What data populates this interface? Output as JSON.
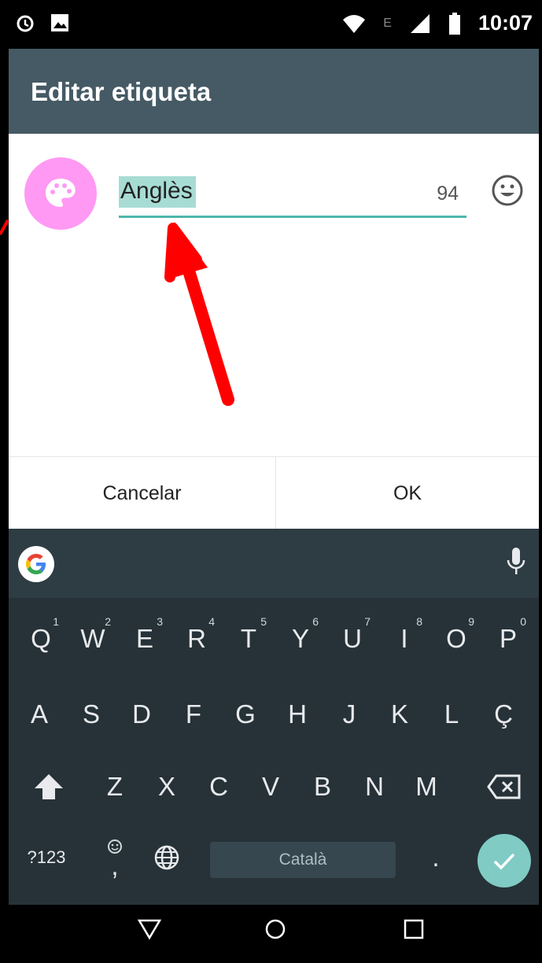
{
  "status_bar": {
    "time": "10:07",
    "network_label": "E",
    "icons": [
      "alarm-icon",
      "image-icon",
      "wifi-icon",
      "signal-icon",
      "battery-icon"
    ]
  },
  "app_bar": {
    "title": "Editar etiqueta"
  },
  "label_editor": {
    "value": "Anglès",
    "remaining_chars": "94",
    "avatar_color": "#ff99f3",
    "accent_color": "#4db6ac",
    "icons": [
      "palette-icon",
      "emoji-icon"
    ]
  },
  "dialog_buttons": {
    "cancel": "Cancelar",
    "ok": "OK"
  },
  "keyboard": {
    "row1": [
      {
        "key": "Q",
        "hint": "1"
      },
      {
        "key": "W",
        "hint": "2"
      },
      {
        "key": "E",
        "hint": "3"
      },
      {
        "key": "R",
        "hint": "4"
      },
      {
        "key": "T",
        "hint": "5"
      },
      {
        "key": "Y",
        "hint": "6"
      },
      {
        "key": "U",
        "hint": "7"
      },
      {
        "key": "I",
        "hint": "8"
      },
      {
        "key": "O",
        "hint": "9"
      },
      {
        "key": "P",
        "hint": "0"
      }
    ],
    "row2": [
      "A",
      "S",
      "D",
      "F",
      "G",
      "H",
      "J",
      "K",
      "L",
      "Ç"
    ],
    "row3": [
      "Z",
      "X",
      "C",
      "V",
      "B",
      "N",
      "M"
    ],
    "symbols_key": "?123",
    "comma_key": ",",
    "period_key": ".",
    "space_label": "Català",
    "enter_color": "#80cbc4",
    "icons": [
      "google-icon",
      "mic-icon",
      "shift-icon",
      "backspace-icon",
      "emoji-comma-icon",
      "globe-icon",
      "check-icon"
    ]
  },
  "nav_bar": {
    "icons": [
      "back-icon",
      "home-icon",
      "recents-icon"
    ]
  },
  "annotation": {
    "arrow_color": "#ff0000"
  }
}
